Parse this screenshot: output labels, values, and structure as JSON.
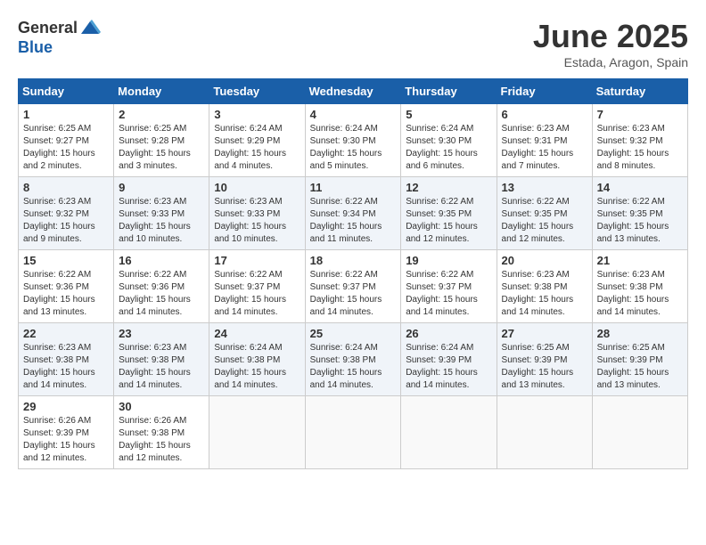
{
  "header": {
    "logo_general": "General",
    "logo_blue": "Blue",
    "month_title": "June 2025",
    "location": "Estada, Aragon, Spain"
  },
  "days_of_week": [
    "Sunday",
    "Monday",
    "Tuesday",
    "Wednesday",
    "Thursday",
    "Friday",
    "Saturday"
  ],
  "weeks": [
    [
      {
        "day": "1",
        "sunrise": "Sunrise: 6:25 AM",
        "sunset": "Sunset: 9:27 PM",
        "daylight": "Daylight: 15 hours and 2 minutes."
      },
      {
        "day": "2",
        "sunrise": "Sunrise: 6:25 AM",
        "sunset": "Sunset: 9:28 PM",
        "daylight": "Daylight: 15 hours and 3 minutes."
      },
      {
        "day": "3",
        "sunrise": "Sunrise: 6:24 AM",
        "sunset": "Sunset: 9:29 PM",
        "daylight": "Daylight: 15 hours and 4 minutes."
      },
      {
        "day": "4",
        "sunrise": "Sunrise: 6:24 AM",
        "sunset": "Sunset: 9:30 PM",
        "daylight": "Daylight: 15 hours and 5 minutes."
      },
      {
        "day": "5",
        "sunrise": "Sunrise: 6:24 AM",
        "sunset": "Sunset: 9:30 PM",
        "daylight": "Daylight: 15 hours and 6 minutes."
      },
      {
        "day": "6",
        "sunrise": "Sunrise: 6:23 AM",
        "sunset": "Sunset: 9:31 PM",
        "daylight": "Daylight: 15 hours and 7 minutes."
      },
      {
        "day": "7",
        "sunrise": "Sunrise: 6:23 AM",
        "sunset": "Sunset: 9:32 PM",
        "daylight": "Daylight: 15 hours and 8 minutes."
      }
    ],
    [
      {
        "day": "8",
        "sunrise": "Sunrise: 6:23 AM",
        "sunset": "Sunset: 9:32 PM",
        "daylight": "Daylight: 15 hours and 9 minutes."
      },
      {
        "day": "9",
        "sunrise": "Sunrise: 6:23 AM",
        "sunset": "Sunset: 9:33 PM",
        "daylight": "Daylight: 15 hours and 10 minutes."
      },
      {
        "day": "10",
        "sunrise": "Sunrise: 6:23 AM",
        "sunset": "Sunset: 9:33 PM",
        "daylight": "Daylight: 15 hours and 10 minutes."
      },
      {
        "day": "11",
        "sunrise": "Sunrise: 6:22 AM",
        "sunset": "Sunset: 9:34 PM",
        "daylight": "Daylight: 15 hours and 11 minutes."
      },
      {
        "day": "12",
        "sunrise": "Sunrise: 6:22 AM",
        "sunset": "Sunset: 9:35 PM",
        "daylight": "Daylight: 15 hours and 12 minutes."
      },
      {
        "day": "13",
        "sunrise": "Sunrise: 6:22 AM",
        "sunset": "Sunset: 9:35 PM",
        "daylight": "Daylight: 15 hours and 12 minutes."
      },
      {
        "day": "14",
        "sunrise": "Sunrise: 6:22 AM",
        "sunset": "Sunset: 9:35 PM",
        "daylight": "Daylight: 15 hours and 13 minutes."
      }
    ],
    [
      {
        "day": "15",
        "sunrise": "Sunrise: 6:22 AM",
        "sunset": "Sunset: 9:36 PM",
        "daylight": "Daylight: 15 hours and 13 minutes."
      },
      {
        "day": "16",
        "sunrise": "Sunrise: 6:22 AM",
        "sunset": "Sunset: 9:36 PM",
        "daylight": "Daylight: 15 hours and 14 minutes."
      },
      {
        "day": "17",
        "sunrise": "Sunrise: 6:22 AM",
        "sunset": "Sunset: 9:37 PM",
        "daylight": "Daylight: 15 hours and 14 minutes."
      },
      {
        "day": "18",
        "sunrise": "Sunrise: 6:22 AM",
        "sunset": "Sunset: 9:37 PM",
        "daylight": "Daylight: 15 hours and 14 minutes."
      },
      {
        "day": "19",
        "sunrise": "Sunrise: 6:22 AM",
        "sunset": "Sunset: 9:37 PM",
        "daylight": "Daylight: 15 hours and 14 minutes."
      },
      {
        "day": "20",
        "sunrise": "Sunrise: 6:23 AM",
        "sunset": "Sunset: 9:38 PM",
        "daylight": "Daylight: 15 hours and 14 minutes."
      },
      {
        "day": "21",
        "sunrise": "Sunrise: 6:23 AM",
        "sunset": "Sunset: 9:38 PM",
        "daylight": "Daylight: 15 hours and 14 minutes."
      }
    ],
    [
      {
        "day": "22",
        "sunrise": "Sunrise: 6:23 AM",
        "sunset": "Sunset: 9:38 PM",
        "daylight": "Daylight: 15 hours and 14 minutes."
      },
      {
        "day": "23",
        "sunrise": "Sunrise: 6:23 AM",
        "sunset": "Sunset: 9:38 PM",
        "daylight": "Daylight: 15 hours and 14 minutes."
      },
      {
        "day": "24",
        "sunrise": "Sunrise: 6:24 AM",
        "sunset": "Sunset: 9:38 PM",
        "daylight": "Daylight: 15 hours and 14 minutes."
      },
      {
        "day": "25",
        "sunrise": "Sunrise: 6:24 AM",
        "sunset": "Sunset: 9:38 PM",
        "daylight": "Daylight: 15 hours and 14 minutes."
      },
      {
        "day": "26",
        "sunrise": "Sunrise: 6:24 AM",
        "sunset": "Sunset: 9:39 PM",
        "daylight": "Daylight: 15 hours and 14 minutes."
      },
      {
        "day": "27",
        "sunrise": "Sunrise: 6:25 AM",
        "sunset": "Sunset: 9:39 PM",
        "daylight": "Daylight: 15 hours and 13 minutes."
      },
      {
        "day": "28",
        "sunrise": "Sunrise: 6:25 AM",
        "sunset": "Sunset: 9:39 PM",
        "daylight": "Daylight: 15 hours and 13 minutes."
      }
    ],
    [
      {
        "day": "29",
        "sunrise": "Sunrise: 6:26 AM",
        "sunset": "Sunset: 9:39 PM",
        "daylight": "Daylight: 15 hours and 12 minutes."
      },
      {
        "day": "30",
        "sunrise": "Sunrise: 6:26 AM",
        "sunset": "Sunset: 9:38 PM",
        "daylight": "Daylight: 15 hours and 12 minutes."
      },
      null,
      null,
      null,
      null,
      null
    ]
  ]
}
